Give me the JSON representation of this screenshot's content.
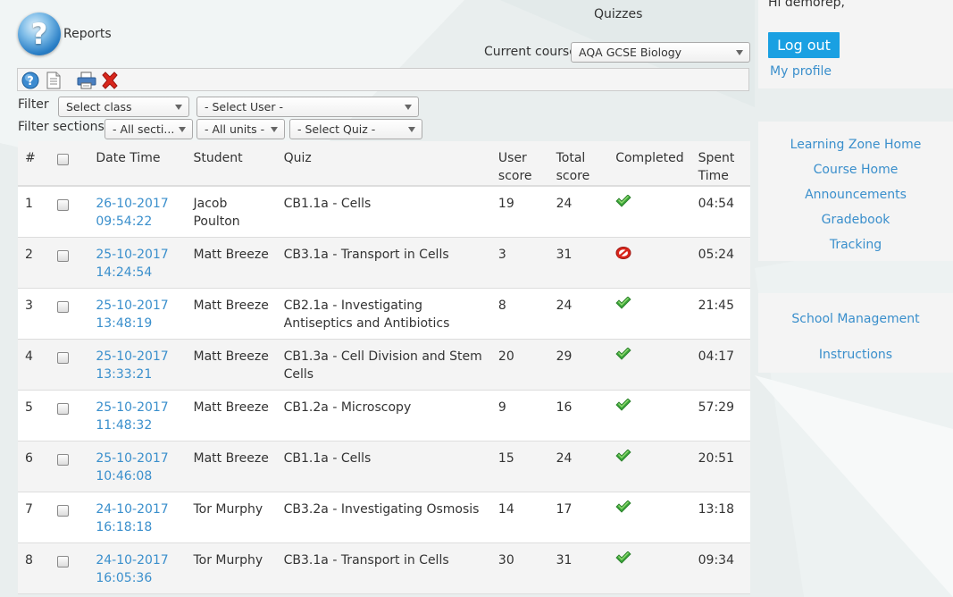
{
  "header": {
    "reports_label": "Reports",
    "page_title": "Quizzes",
    "course_label": "Current course",
    "course_value": "AQA GCSE Biology"
  },
  "filters": {
    "filter_label": "Filter",
    "class_select": "Select class",
    "user_select": "- Select User -",
    "sections_label": "Filter sections",
    "sections_select": "- All secti...",
    "units_select": "- All units -",
    "quiz_select": "- Select Quiz -"
  },
  "table": {
    "headers": {
      "num": "#",
      "datetime": "Date Time",
      "student": "Student",
      "quiz": "Quiz",
      "user_score": "User score",
      "total_score": "Total score",
      "completed": "Completed",
      "spent_time": "Spent Time"
    },
    "rows": [
      {
        "num": "1",
        "date": "26-10-2017",
        "time": "09:54:22",
        "student": "Jacob Poulton",
        "quiz": "CB1.1a - Cells",
        "user_score": "19",
        "total_score": "24",
        "completed": true,
        "spent": "04:54"
      },
      {
        "num": "2",
        "date": "25-10-2017",
        "time": "14:24:54",
        "student": "Matt Breeze",
        "quiz": "CB3.1a - Transport in Cells",
        "user_score": "3",
        "total_score": "31",
        "completed": false,
        "spent": "05:24"
      },
      {
        "num": "3",
        "date": "25-10-2017",
        "time": "13:48:19",
        "student": "Matt Breeze",
        "quiz": "CB2.1a - Investigating Antiseptics and Antibiotics",
        "user_score": "8",
        "total_score": "24",
        "completed": true,
        "spent": "21:45"
      },
      {
        "num": "4",
        "date": "25-10-2017",
        "time": "13:33:21",
        "student": "Matt Breeze",
        "quiz": "CB1.3a - Cell Division and Stem Cells",
        "user_score": "20",
        "total_score": "29",
        "completed": true,
        "spent": "04:17"
      },
      {
        "num": "5",
        "date": "25-10-2017",
        "time": "11:48:32",
        "student": "Matt Breeze",
        "quiz": "CB1.2a - Microscopy",
        "user_score": "9",
        "total_score": "16",
        "completed": true,
        "spent": "57:29"
      },
      {
        "num": "6",
        "date": "25-10-2017",
        "time": "10:46:08",
        "student": "Matt Breeze",
        "quiz": "CB1.1a - Cells",
        "user_score": "15",
        "total_score": "24",
        "completed": true,
        "spent": "20:51"
      },
      {
        "num": "7",
        "date": "24-10-2017",
        "time": "16:18:18",
        "student": "Tor Murphy",
        "quiz": "CB3.2a - Investigating Osmosis",
        "user_score": "14",
        "total_score": "17",
        "completed": true,
        "spent": "13:18"
      },
      {
        "num": "8",
        "date": "24-10-2017",
        "time": "16:05:36",
        "student": "Tor Murphy",
        "quiz": "CB3.1a - Transport in Cells",
        "user_score": "30",
        "total_score": "31",
        "completed": true,
        "spent": "09:34"
      }
    ]
  },
  "user_panel": {
    "greeting": "Hi demorep,",
    "logout_label": "Log out",
    "profile_label": "My profile"
  },
  "nav": {
    "items": [
      "Learning Zone Home",
      "Course Home",
      "Announcements",
      "Gradebook",
      "Tracking"
    ],
    "items2": [
      "School Management",
      "Instructions"
    ]
  },
  "icons": {
    "reports": "help-question-icon",
    "toolbar": [
      "help-icon",
      "document-icon",
      "print-icon",
      "delete-icon"
    ],
    "completed_yes": "checkmark-icon",
    "completed_no": "not-completed-icon"
  },
  "colors": {
    "link": "#3a8fcc",
    "logout_bg": "#1aa0e2",
    "check_green": "#3aa33a",
    "fail_red": "#d9261c"
  }
}
